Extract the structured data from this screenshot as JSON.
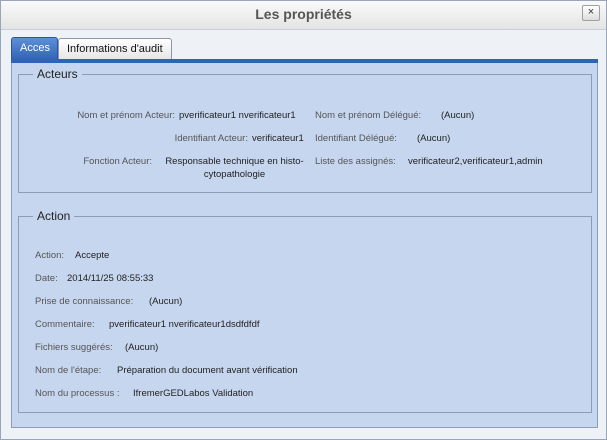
{
  "dialog": {
    "title": "Les propriétés",
    "close_label": "×"
  },
  "tabs": [
    {
      "label": "Acces",
      "active": true
    },
    {
      "label": "Informations d'audit",
      "active": false
    }
  ],
  "acteurs": {
    "legend": "Acteurs",
    "nom_acteur_label": "Nom et prénom Acteur:",
    "nom_acteur_value": "pverificateur1 nverificateur1",
    "id_acteur_label": "Identifiant Acteur:",
    "id_acteur_value": "verificateur1",
    "fonction_acteur_label": "Fonction Acteur:",
    "fonction_acteur_value_line1": "Responsable technique en histo-",
    "fonction_acteur_value_line2": "cytopathologie",
    "nom_delegue_label": "Nom et prénom Délégué:",
    "nom_delegue_value": "(Aucun)",
    "id_delegue_label": "Identifiant Délégué:",
    "id_delegue_value": "(Aucun)",
    "assignes_label": "Liste des assignés:",
    "assignes_value": "verificateur2,verificateur1,admin"
  },
  "action": {
    "legend": "Action",
    "action_label": "Action:",
    "action_value": "Accepte",
    "date_label": "Date:",
    "date_value": "2014/11/25 08:55:33",
    "prise_label": "Prise de connaissance:",
    "prise_value": "(Aucun)",
    "commentaire_label": "Commentaire:",
    "commentaire_value": "pverificateur1 nverificateur1dsdfdfdf",
    "fichiers_label": "Fichiers suggérés:",
    "fichiers_value": "(Aucun)",
    "etape_label": "Nom de l'étape:",
    "etape_value": "Préparation du document avant vérification",
    "processus_label": "Nom du processus :",
    "processus_value": "IfremerGEDLabos Validation"
  },
  "colors": {
    "panel_bg": "#c6d6ef",
    "tab_active": "#2f63b6"
  }
}
